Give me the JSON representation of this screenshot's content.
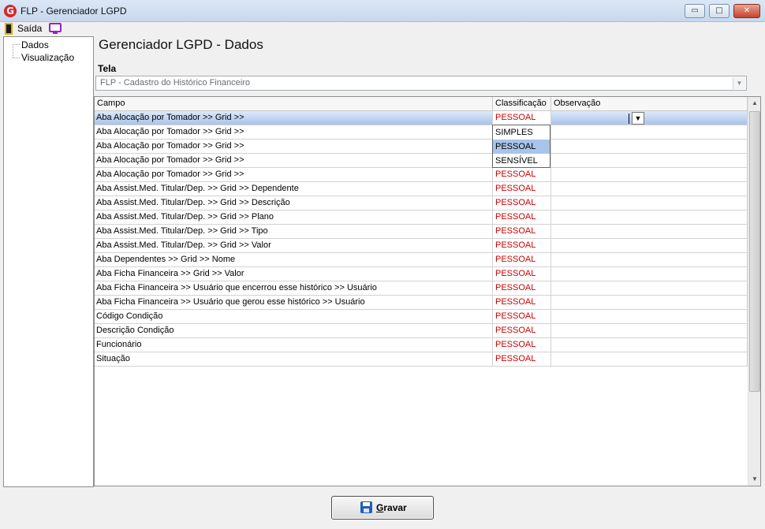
{
  "window": {
    "title": "FLP - Gerenciador LGPD",
    "app_icon_glyph": "G",
    "minimize_glyph": "▭",
    "maximize_glyph": "□",
    "close_glyph": "✕"
  },
  "menu": {
    "exit_label": "Saída"
  },
  "tree": {
    "items": [
      "Dados",
      "Visualização"
    ]
  },
  "page_title": "Gerenciador LGPD - Dados",
  "tela": {
    "label": "Tela",
    "value": "FLP - Cadastro do Histórico Financeiro"
  },
  "grid": {
    "columns": [
      "Campo",
      "Classificação",
      "Observação"
    ],
    "rows": [
      {
        "campo": "Aba Alocação por Tomador >> Grid >>",
        "classificacao": "PESSOAL",
        "observacao": ""
      },
      {
        "campo": "Aba Alocação por Tomador >> Grid >>",
        "classificacao": "",
        "observacao": ""
      },
      {
        "campo": "Aba Alocação por Tomador >> Grid >>",
        "classificacao": "",
        "observacao": ""
      },
      {
        "campo": "Aba Alocação por Tomador >> Grid >>",
        "classificacao": "",
        "observacao": ""
      },
      {
        "campo": "Aba Alocação por Tomador >> Grid >>",
        "classificacao": "PESSOAL",
        "observacao": ""
      },
      {
        "campo": "Aba Assist.Med. Titular/Dep. >> Grid >> Dependente",
        "classificacao": "PESSOAL",
        "observacao": ""
      },
      {
        "campo": "Aba Assist.Med. Titular/Dep. >> Grid >> Descrição",
        "classificacao": "PESSOAL",
        "observacao": ""
      },
      {
        "campo": "Aba Assist.Med. Titular/Dep. >> Grid >> Plano",
        "classificacao": "PESSOAL",
        "observacao": ""
      },
      {
        "campo": "Aba Assist.Med. Titular/Dep. >> Grid >> Tipo",
        "classificacao": "PESSOAL",
        "observacao": ""
      },
      {
        "campo": "Aba Assist.Med. Titular/Dep. >> Grid >> Valor",
        "classificacao": "PESSOAL",
        "observacao": ""
      },
      {
        "campo": "Aba Dependentes >> Grid >> Nome",
        "classificacao": "PESSOAL",
        "observacao": ""
      },
      {
        "campo": "Aba Ficha Financeira >> Grid >> Valor",
        "classificacao": "PESSOAL",
        "observacao": ""
      },
      {
        "campo": "Aba Ficha Financeira >> Usuário que encerrou esse histórico >> Usuário",
        "classificacao": "PESSOAL",
        "observacao": ""
      },
      {
        "campo": "Aba Ficha Financeira >> Usuário que gerou esse histórico >> Usuário",
        "classificacao": "PESSOAL",
        "observacao": ""
      },
      {
        "campo": "Código Condição",
        "classificacao": "PESSOAL",
        "observacao": ""
      },
      {
        "campo": "Descrição Condição",
        "classificacao": "PESSOAL",
        "observacao": ""
      },
      {
        "campo": "Funcionário",
        "classificacao": "PESSOAL",
        "observacao": ""
      },
      {
        "campo": "Situação",
        "classificacao": "PESSOAL",
        "observacao": ""
      }
    ],
    "dropdown_options": [
      "SIMPLES",
      "PESSOAL",
      "SENSÍVEL"
    ],
    "dropdown_selected": "PESSOAL"
  },
  "save_button": {
    "label": "Gravar"
  },
  "colors": {
    "classification_text": "#cc0000",
    "selected_row": "#a9c4ea",
    "save_icon": "#1f5fb6"
  }
}
